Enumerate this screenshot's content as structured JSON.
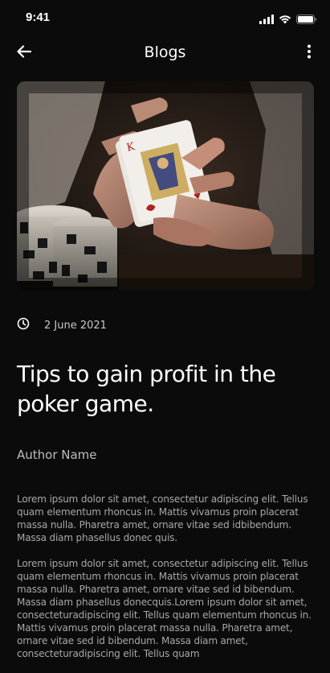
{
  "status_bar": {
    "time": "9:41",
    "icons": [
      "signal-icon",
      "wifi-icon",
      "battery-icon"
    ]
  },
  "header": {
    "title": "Blogs",
    "back_icon": "arrow-left-icon",
    "menu_icon": "more-vertical-icon"
  },
  "post": {
    "hero_image": "playing-cards-hands-photo",
    "date_icon": "clock-icon",
    "date": "2 June 2021",
    "title": "Tips to gain profit in the poker game.",
    "author": "Author Name",
    "paragraphs": [
      "Lorem ipsum dolor sit amet, consectetur adipiscing elit. Tellus quam elementum rhoncus in. Mattis vivamus proin placerat massa nulla. Pharetra amet, ornare vitae sed idbibendum. Massa diam phasellus donec quis.",
      "Lorem ipsum dolor sit amet, consectetur adipiscing elit. Tellus quam elementum rhoncus in. Mattis vivamus proin placerat massa nulla. Pharetra amet, ornare vitae sed id bibendum. Massa diam phasellus donecquis.Lorem ipsum dolor sit amet, consecteturadipiscing elit. Tellus quam elementum rhoncus in. Mattis vivamus proin placerat massa nulla. Pharetra amet, ornare vitae sed id bibendum. Massa diam amet, consecteturadipiscing elit. Tellus quam"
    ]
  },
  "colors": {
    "background": "#0b0b0b",
    "text_primary": "#ffffff",
    "text_secondary": "#a8a8a8"
  }
}
